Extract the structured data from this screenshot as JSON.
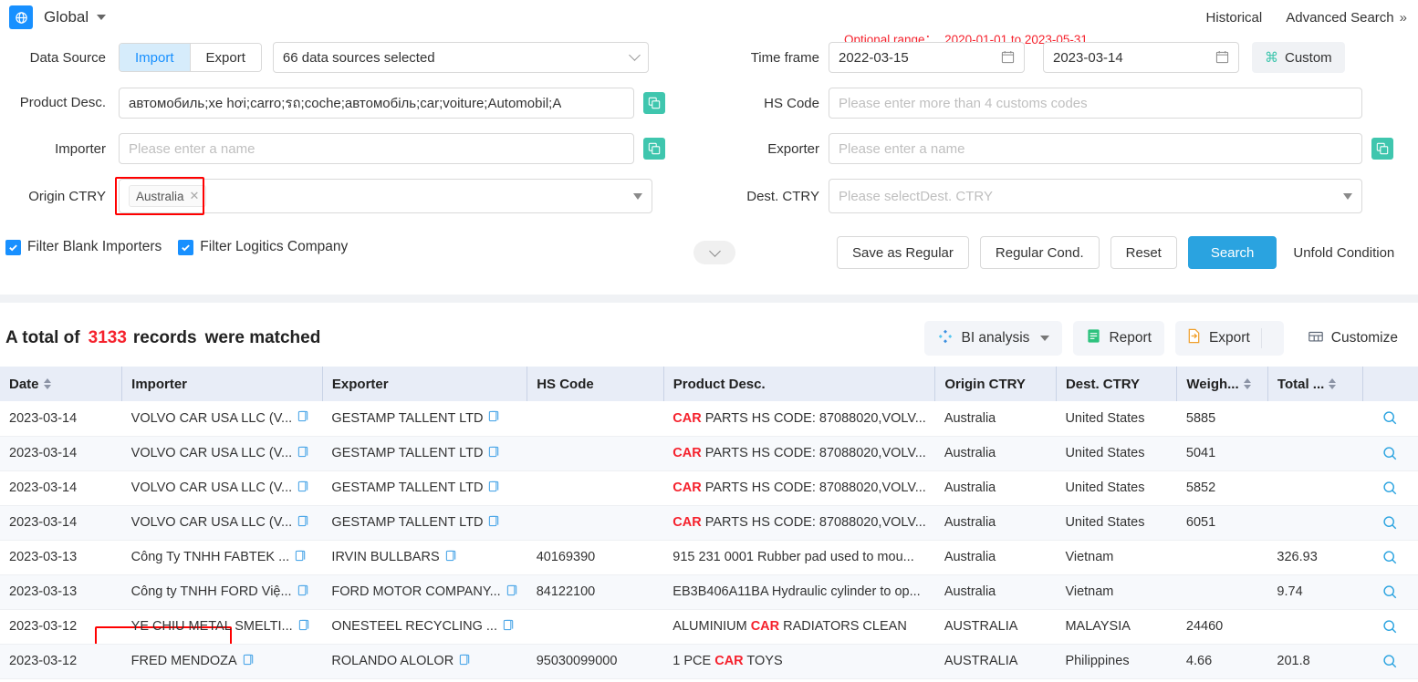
{
  "topbar": {
    "brand_label": "Global",
    "globe_icon": "globe-icon",
    "historical_label": "Historical",
    "advanced_search_label": "Advanced Search",
    "expand_icon": "double-chevron-right-icon"
  },
  "search": {
    "optional_range_label": "Optional range：",
    "optional_range_value": "2020-01-01 to 2023-05-31",
    "data_source_label": "Data Source",
    "import_label": "Import",
    "export_label": "Export",
    "data_sources_value": "66 data sources selected",
    "time_frame_label": "Time frame",
    "date_from": "2022-03-15",
    "date_to": "2023-03-14",
    "custom_label": "Custom",
    "custom_icon": "command-icon",
    "product_desc_label": "Product Desc.",
    "product_desc_value": "автомобиль;xe hơi;carro;รถ;coche;автомобіль;car;voiture;Automobil;A",
    "hs_code_label": "HS Code",
    "hs_code_placeholder": "Please enter more than 4 customs codes",
    "importer_label": "Importer",
    "importer_placeholder": "Please enter a name",
    "exporter_label": "Exporter",
    "exporter_placeholder": "Please enter a name",
    "origin_ctry_label": "Origin CTRY",
    "origin_ctry_tag": "Australia",
    "dest_ctry_label": "Dest. CTRY",
    "dest_ctry_placeholder": "Please selectDest. CTRY",
    "filter_blank_importers_label": "Filter Blank Importers",
    "filter_logitics_label": "Filter Logitics Company",
    "save_as_regular_label": "Save as Regular",
    "regular_cond_label": "Regular Cond.",
    "reset_label": "Reset",
    "search_label": "Search",
    "unfold_condition_label": "Unfold Condition",
    "accent_color": "#2aa3e0",
    "highlight_color": "#ff0000"
  },
  "results": {
    "prefix": "A total of",
    "count": "3133",
    "records_word": "records",
    "suffix": "were matched",
    "bi_analysis_label": "BI analysis",
    "bi_analysis_icon": "bi-analysis-icon",
    "report_label": "Report",
    "report_icon": "report-icon",
    "export_label": "Export",
    "export_icon": "export-icon",
    "customize_label": "Customize",
    "customize_icon": "customize-icon"
  },
  "table": {
    "columns": [
      {
        "label": "Date",
        "sortable": true
      },
      {
        "label": "Importer",
        "sortable": false
      },
      {
        "label": "Exporter",
        "sortable": false
      },
      {
        "label": "HS Code",
        "sortable": false
      },
      {
        "label": "Product Desc.",
        "sortable": false
      },
      {
        "label": "Origin CTRY",
        "sortable": false
      },
      {
        "label": "Dest. CTRY",
        "sortable": false
      },
      {
        "label": "Weigh...",
        "sortable": true
      },
      {
        "label": "Total ...",
        "sortable": true
      },
      {
        "label": "",
        "sortable": false
      }
    ],
    "rows": [
      {
        "date": "2023-03-14",
        "importer": "VOLVO CAR USA LLC (V...",
        "exporter": "GESTAMP TALLENT LTD",
        "hs_code": "",
        "product_hl": "CAR",
        "product_rest": " PARTS HS CODE: 87088020,VOLV...",
        "origin": "Australia",
        "dest": "United States",
        "weight": "5885",
        "total": ""
      },
      {
        "date": "2023-03-14",
        "importer": "VOLVO CAR USA LLC (V...",
        "exporter": "GESTAMP TALLENT LTD",
        "hs_code": "",
        "product_hl": "CAR",
        "product_rest": " PARTS HS CODE: 87088020,VOLV...",
        "origin": "Australia",
        "dest": "United States",
        "weight": "5041",
        "total": ""
      },
      {
        "date": "2023-03-14",
        "importer": "VOLVO CAR USA LLC (V...",
        "exporter": "GESTAMP TALLENT LTD",
        "hs_code": "",
        "product_hl": "CAR",
        "product_rest": " PARTS HS CODE: 87088020,VOLV...",
        "origin": "Australia",
        "dest": "United States",
        "weight": "5852",
        "total": ""
      },
      {
        "date": "2023-03-14",
        "importer": "VOLVO CAR USA LLC (V...",
        "exporter": "GESTAMP TALLENT LTD",
        "hs_code": "",
        "product_hl": "CAR",
        "product_rest": " PARTS HS CODE: 87088020,VOLV...",
        "origin": "Australia",
        "dest": "United States",
        "weight": "6051",
        "total": ""
      },
      {
        "date": "2023-03-13",
        "importer": "Công Ty TNHH FABTEK ...",
        "exporter": "IRVIN BULLBARS",
        "hs_code": "40169390",
        "product_hl": "",
        "product_rest": "915 231 0001 Rubber pad used to mou...",
        "origin": "Australia",
        "dest": "Vietnam",
        "weight": "",
        "total": "326.93"
      },
      {
        "date": "2023-03-13",
        "importer": "Công ty TNHH FORD Việ...",
        "exporter": "FORD MOTOR COMPANY...",
        "hs_code": "84122100",
        "product_hl": "",
        "product_rest": "EB3B406A11BA Hydraulic cylinder to op...",
        "origin": "Australia",
        "dest": "Vietnam",
        "weight": "",
        "total": "9.74"
      },
      {
        "date": "2023-03-12",
        "importer": "YE CHIU METAL SMELTI...",
        "exporter": "ONESTEEL RECYCLING ...",
        "hs_code": "",
        "product_pre": "ALUMINIUM ",
        "product_hl": "CAR",
        "product_rest": " RADIATORS CLEAN",
        "origin": "AUSTRALIA",
        "dest": "MALAYSIA",
        "weight": "24460",
        "total": ""
      },
      {
        "date": "2023-03-12",
        "importer": "FRED MENDOZA",
        "exporter": "ROLANDO ALOLOR",
        "hs_code": "95030099000",
        "product_pre": "1 PCE ",
        "product_hl": "CAR",
        "product_rest": " TOYS",
        "origin": "AUSTRALIA",
        "dest": "Philippines",
        "weight": "4.66",
        "total": "201.8"
      }
    ],
    "copy_icon": "copy-icon",
    "detail_icon": "magnifier-icon"
  }
}
